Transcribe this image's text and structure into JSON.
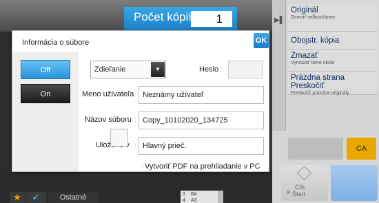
{
  "copies": {
    "label": "Počet kópií",
    "value": "1"
  },
  "right_menu": {
    "items": [
      {
        "title": "Originál",
        "subtitle": "Zmeniť veľkosť/smer."
      },
      {
        "title": "Obojstr. kópia",
        "subtitle": ""
      },
      {
        "title": "Zmazať",
        "subtitle": "Vymazať tiene okolo"
      },
      {
        "title": "Prázdna strana Preskočiť",
        "subtitle": "Preskočiť prázdne originály"
      }
    ],
    "ca_label": "CA",
    "start_bw": {
      "line1": "C/b",
      "line2": "Štart"
    }
  },
  "bottom_bar": {
    "other_label": "Ostatné",
    "paper": [
      {
        "tray": "3",
        "size": "B4"
      },
      {
        "tray": "4",
        "size": "A3"
      }
    ]
  },
  "dialog": {
    "title": "Informácia o súbore",
    "ok_label": "OK",
    "off_label": "Off",
    "on_label": "On",
    "share_select": "Zdieľanie",
    "password_label": "Heslo",
    "username_label": "Meno užívateľa",
    "username_value": "Neznámy užívateľ",
    "filename_label": "Názov súboru",
    "filename_value": "Copy_10102020_134725",
    "saved_label": "Uložené v",
    "saved_value": "Hlavný prieč.",
    "pdf_checkbox_label": "Vytvoriť PDF na prehliadanie v PC"
  },
  "colors": {
    "accent_blue": "#2b93dc",
    "ca_yellow": "#e8a800"
  }
}
